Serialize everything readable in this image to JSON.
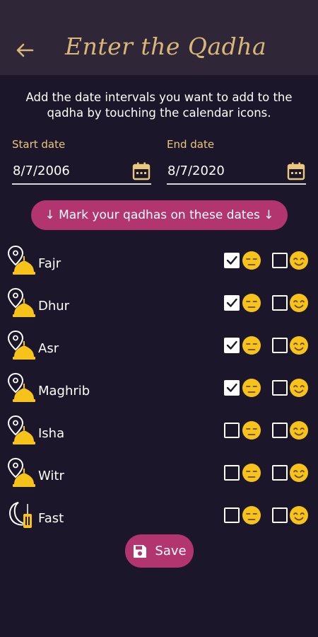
{
  "header": {
    "title": "Enter the Qadha",
    "back_icon": "back-arrow-icon",
    "title_color": "#d9b779"
  },
  "intro": "Add the date intervals you want to add to the qadha by touching the calendar icons.",
  "start_date": {
    "label": "Start date",
    "value": "8/7/2006",
    "icon": "calendar-icon"
  },
  "end_date": {
    "label": "End date",
    "value": "8/7/2020",
    "icon": "calendar-icon"
  },
  "mark_button": {
    "label": "↓  Mark your qadhas on these dates  ↓"
  },
  "prayers": [
    {
      "name": "Fajr",
      "icon": "mosque-pin-icon",
      "missed": true,
      "prayed": false
    },
    {
      "name": "Dhur",
      "icon": "mosque-pin-icon",
      "missed": true,
      "prayed": false
    },
    {
      "name": "Asr",
      "icon": "mosque-pin-icon",
      "missed": true,
      "prayed": false
    },
    {
      "name": "Maghrib",
      "icon": "mosque-pin-icon",
      "missed": true,
      "prayed": false
    },
    {
      "name": "Isha",
      "icon": "mosque-pin-icon",
      "missed": false,
      "prayed": false
    },
    {
      "name": "Witr",
      "icon": "mosque-pin-icon",
      "missed": false,
      "prayed": false
    },
    {
      "name": "Fast",
      "icon": "crescent-lantern-icon",
      "missed": false,
      "prayed": false
    }
  ],
  "save_button": {
    "label": "Save",
    "icon": "floppy-disk-icon"
  },
  "colors": {
    "accent": "#b3356f",
    "gold": "#e9c77c",
    "emoji": "#f7c21a",
    "background": "#1b1629",
    "appbar": "#2f2637"
  }
}
